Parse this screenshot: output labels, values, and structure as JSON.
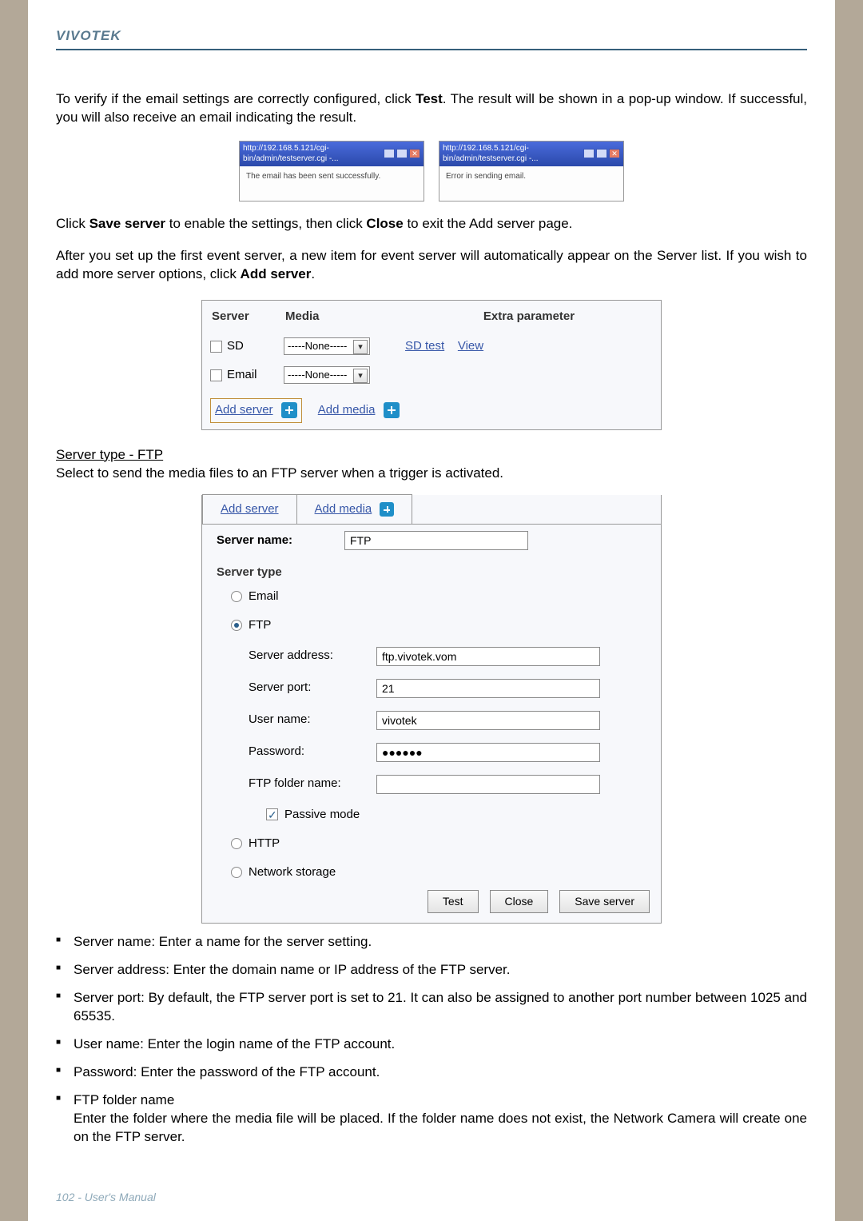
{
  "brand": "VIVOTEK",
  "intro_verify": "To verify if the email settings are correctly configured, click ",
  "test_bold": "Test",
  "intro_verify_tail": ". The result will be shown in a pop-up window. If successful, you will also receive an email indicating the result.",
  "popup_url_left": "http://192.168.5.121/cgi-bin/admin/testserver.cgi -...",
  "popup_url_right": "http://192.168.5.121/cgi-bin/admin/testserver.cgi -...",
  "popup_msg_success": "The email has been sent successfully.",
  "popup_msg_error": "Error in sending email.",
  "click_save_1": "Click ",
  "save_server_bold": "Save server",
  "click_save_2": " to enable the settings, then click ",
  "close_bold": "Close",
  "click_save_3": " to exit the Add server page.",
  "after_setup_1": "After you set up the first event server, a new item for event server will automatically appear on the Server list. If you wish to add more server options, click ",
  "add_server_bold": "Add server",
  "after_setup_2": ".",
  "server_table": {
    "h_server": "Server",
    "h_media": "Media",
    "h_extra": "Extra parameter",
    "row_sd": "SD",
    "row_email": "Email",
    "none_option": "-----None-----",
    "sd_test": "SD test",
    "view": "View",
    "add_server": "Add server",
    "add_media": "Add media"
  },
  "ftp_section_title": "Server type - FTP",
  "ftp_section_desc": "Select to send the media files to an FTP server when a trigger is activated.",
  "ftp_panel": {
    "tab_add_server": "Add server",
    "tab_add_media": "Add media",
    "server_name_label": "Server name:",
    "server_name_val": "FTP",
    "server_type_label": "Server type",
    "opt_email": "Email",
    "opt_ftp": "FTP",
    "server_address_label": "Server address:",
    "server_address_val": "ftp.vivotek.vom",
    "server_port_label": "Server port:",
    "server_port_val": "21",
    "user_name_label": "User name:",
    "user_name_val": "vivotek",
    "password_label": "Password:",
    "password_val": "●●●●●●",
    "ftp_folder_label": "FTP folder name:",
    "ftp_folder_val": "",
    "passive_mode": "Passive mode",
    "opt_http": "HTTP",
    "opt_ns": "Network storage",
    "btn_test": "Test",
    "btn_close": "Close",
    "btn_save": "Save server"
  },
  "bullets": {
    "b1": "Server name: Enter a name for the server setting.",
    "b2": "Server address: Enter the domain name or IP address of the FTP server.",
    "b3": "Server port: By default, the FTP server port is set to 21. It can also be assigned to another port number between 1025 and 65535.",
    "b4": "User name: Enter the login name of the FTP account.",
    "b5": "Password: Enter the password of the FTP account.",
    "b6h": "FTP folder name",
    "b6b": "Enter the folder where the media file will be placed. If the folder name does not exist, the Network Camera will create one on the FTP server."
  },
  "footer": "102 - User's Manual"
}
